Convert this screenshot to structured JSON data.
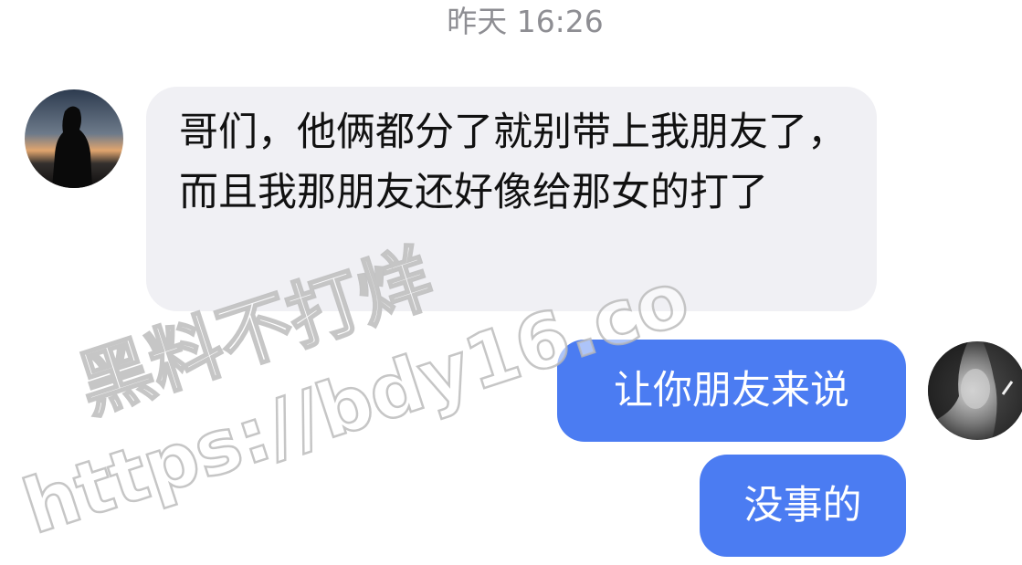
{
  "chat": {
    "timestamp": "昨天 16:26",
    "messages": [
      {
        "sender": "other",
        "text": "哥们，他俩都分了就别带上我朋友了，而且我那朋友还好像给那女的打了"
      },
      {
        "sender": "self",
        "text": "让你朋友来说"
      },
      {
        "sender": "self",
        "text": "没事的"
      }
    ]
  },
  "watermark": {
    "line1": "黑料不打烊",
    "line2": "https://bdy16.co"
  },
  "colors": {
    "incoming_bubble": "#f0f0f4",
    "outgoing_bubble": "#4b7cf2",
    "timestamp_text": "#8e8e93"
  }
}
